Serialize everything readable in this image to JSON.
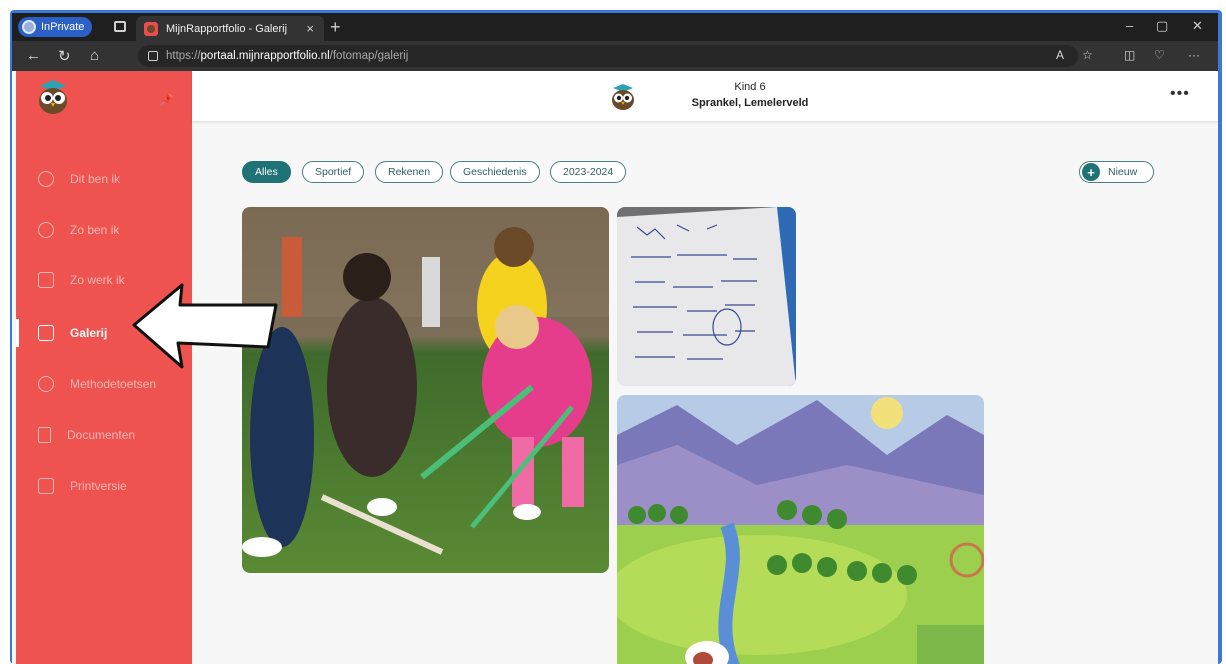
{
  "browser": {
    "inprivate_label": "InPrivate",
    "tab_title": "MijnRapportfolio - Galerij",
    "tab_close": "×",
    "new_tab": "+",
    "url_protocol": "https://",
    "url_host": "portaal.mijnrapportfolio.nl",
    "url_path": "/fotomap/galerij",
    "window_controls": [
      "–",
      "▢",
      "✕"
    ]
  },
  "header": {
    "child_name": "Kind 6",
    "school": "Sprankel, Lemelerveld",
    "more": "•••"
  },
  "sidebar": {
    "items": [
      {
        "label": "Dit ben ik",
        "icon": "chat-smile-icon"
      },
      {
        "label": "Zo ben ik",
        "icon": "person-circle-icon"
      },
      {
        "label": "Zo werk ik",
        "icon": "thumbs-up-icon"
      },
      {
        "label": "Galerij",
        "icon": "camera-icon",
        "active": true
      },
      {
        "label": "Methodetoetsen",
        "icon": "target-icon"
      },
      {
        "label": "Documenten",
        "icon": "document-icon"
      },
      {
        "label": "Printversie",
        "icon": "printer-icon"
      }
    ]
  },
  "filters": [
    "Alles",
    "Sportief",
    "Rekenen",
    "Geschiedenis",
    "2023-2024"
  ],
  "new_button": "Nieuw",
  "colors": {
    "sidebar": "#ef5350",
    "accent": "#1f7275",
    "frame": "#3b78d8"
  }
}
